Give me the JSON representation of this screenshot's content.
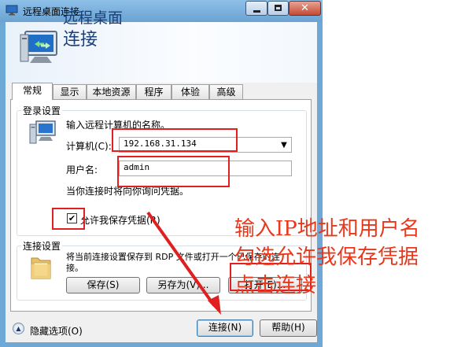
{
  "window": {
    "title": "远程桌面连接",
    "close_glyph": "✕"
  },
  "header": {
    "line1": "远程桌面",
    "line2": "连接"
  },
  "tabs": [
    {
      "label": "常规"
    },
    {
      "label": "显示"
    },
    {
      "label": "本地资源"
    },
    {
      "label": "程序"
    },
    {
      "label": "体验"
    },
    {
      "label": "高级"
    }
  ],
  "login": {
    "legend": "登录设置",
    "instruction": "输入远程计算机的名称。",
    "computer_label": "计算机(C):",
    "computer_value": "192.168.31.134",
    "username_label": "用户名:",
    "username_value": "admin",
    "note": "当你连接时将向你询问凭据。",
    "save_credentials_label": "允许我保存凭据(R)",
    "save_credentials_checked": true,
    "check_glyph": "✔"
  },
  "connection": {
    "legend": "连接设置",
    "description": "将当前连接设置保存到 RDP 文件或打开一个已保存的连接。",
    "save_button": "保存(S)",
    "save_as_button": "另存为(V)...",
    "open_button": "打开(E)..."
  },
  "footer": {
    "hide_options": "隐藏选项(O)",
    "connect_button": "连接(N)",
    "help_button": "帮助(H)",
    "expand_glyph": "▲"
  },
  "annotation": {
    "line1": "输入IP地址和用户名",
    "line2": "勾选允许我保存凭据",
    "line3": "点击连接",
    "color": "#e8381c"
  },
  "colors": {
    "accent": "#1c3f78",
    "annotation_red": "#e02020"
  }
}
